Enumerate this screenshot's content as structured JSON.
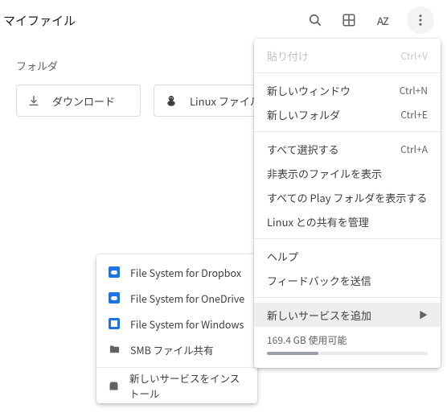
{
  "header": {
    "title": "マイファイル",
    "icons": {
      "search": "search-icon",
      "view": "thumbnail-view-icon",
      "sort": "sort-az-icon",
      "more": "more-vert-icon"
    }
  },
  "section_label": "フォルダ",
  "folders": [
    {
      "id": "downloads",
      "label": "ダウンロード"
    },
    {
      "id": "linux",
      "label": "Linux ファイル"
    }
  ],
  "menu": {
    "items": [
      {
        "label": "貼り付け",
        "shortcut": "Ctrl+V",
        "disabled": true
      },
      {
        "type": "divider"
      },
      {
        "label": "新しいウィンドウ",
        "shortcut": "Ctrl+N"
      },
      {
        "label": "新しいフォルダ",
        "shortcut": "Ctrl+E"
      },
      {
        "type": "divider"
      },
      {
        "label": "すべて選択する",
        "shortcut": "Ctrl+A"
      },
      {
        "label": "非表示のファイルを表示"
      },
      {
        "label": "すべての Play フォルダを表示する"
      },
      {
        "label": "Linux との共有を管理"
      },
      {
        "type": "divider"
      },
      {
        "label": "ヘルプ"
      },
      {
        "label": "フィードバックを送信"
      },
      {
        "type": "divider"
      },
      {
        "label": "新しいサービスを追加",
        "submenu": true,
        "highlight": true
      }
    ],
    "storage": {
      "label": "169.4 GB 使用可能",
      "used_percent": 32
    }
  },
  "submenu": {
    "items": [
      {
        "icon": "dropbox",
        "label": "File System for Dropbox"
      },
      {
        "icon": "onedrive",
        "label": "File System for OneDrive"
      },
      {
        "icon": "windows",
        "label": "File System for Windows"
      },
      {
        "icon": "smb",
        "label": "SMB ファイル共有"
      }
    ],
    "divider": true,
    "install": {
      "icon": "webstore",
      "label": "新しいサービスをインストール"
    }
  }
}
